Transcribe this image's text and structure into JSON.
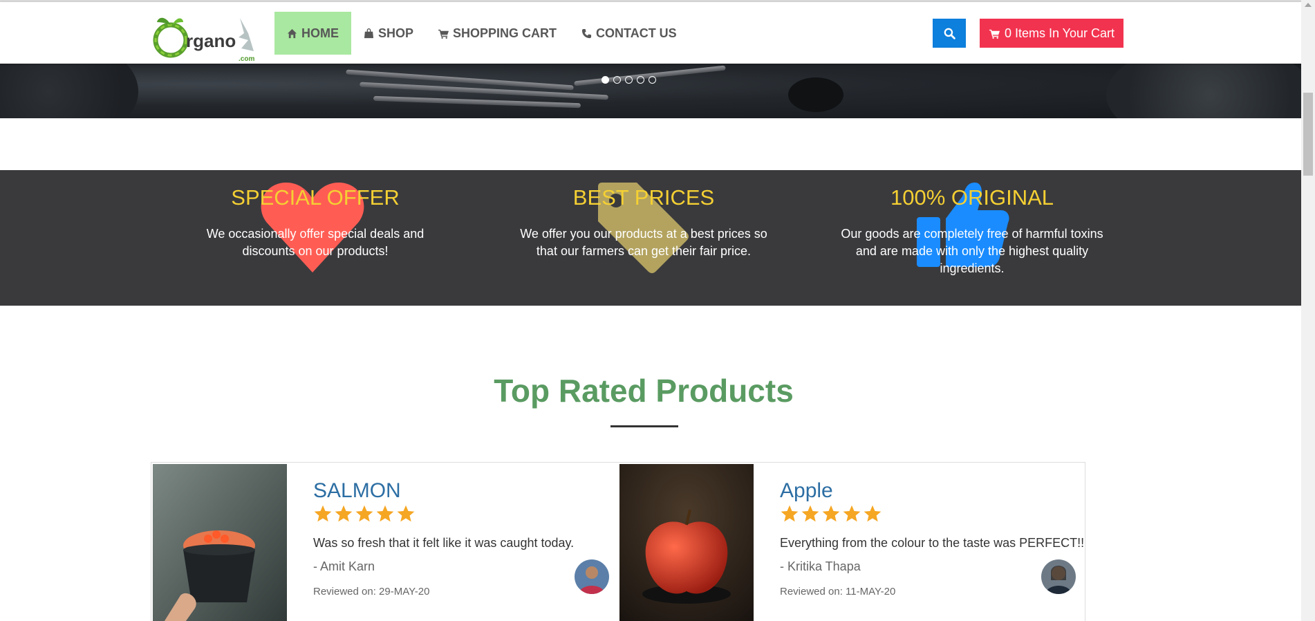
{
  "header": {
    "logo_alt": "Organo .com",
    "nav": [
      {
        "label": "HOME",
        "icon": "home-icon",
        "active": true
      },
      {
        "label": "SHOP",
        "icon": "shopping-bag-icon",
        "active": false
      },
      {
        "label": "SHOPPING CART",
        "icon": "shopping-cart-icon",
        "active": false
      },
      {
        "label": "CONTACT US",
        "icon": "phone-icon",
        "active": false
      }
    ],
    "search_icon": "search-icon",
    "cart_button": {
      "icon": "shopping-cart-icon",
      "label": "0 Items In Your Cart"
    },
    "colors": {
      "active_nav": "#a9e8a0",
      "search": "#0d7fdc",
      "cart": "#f2334f"
    }
  },
  "carousel": {
    "slides": 5,
    "active_index": 0
  },
  "features": [
    {
      "title": "SPECIAL OFFER",
      "text": "We occasionally offer special deals and discounts on our products!",
      "icon": "heart-icon",
      "icon_color": "#ff5d54"
    },
    {
      "title": "BEST PRICES",
      "text": "We offer you our products at a best prices so that our farmers can get their fair price.",
      "icon": "price-tag-icon",
      "icon_color": "#b3a35f"
    },
    {
      "title": "100% ORIGINAL",
      "text": "Our goods are completely free of harmful toxins and are made with only the highest quality ingredients.",
      "icon": "thumbs-up-icon",
      "icon_color": "#1a8cff"
    }
  ],
  "top_rated": {
    "title": "Top Rated Products",
    "reviews": [
      {
        "product": "SALMON",
        "rating": 5,
        "text": "Was so fresh that it felt like it was caught today.",
        "author": "- Amit Karn",
        "date": "Reviewed on: 29-MAY-20"
      },
      {
        "product": "Apple",
        "rating": 5,
        "text": "Everything from the colour to the taste was PERFECT!!",
        "author": "- Kritika Thapa",
        "date": "Reviewed on: 11-MAY-20"
      }
    ]
  }
}
